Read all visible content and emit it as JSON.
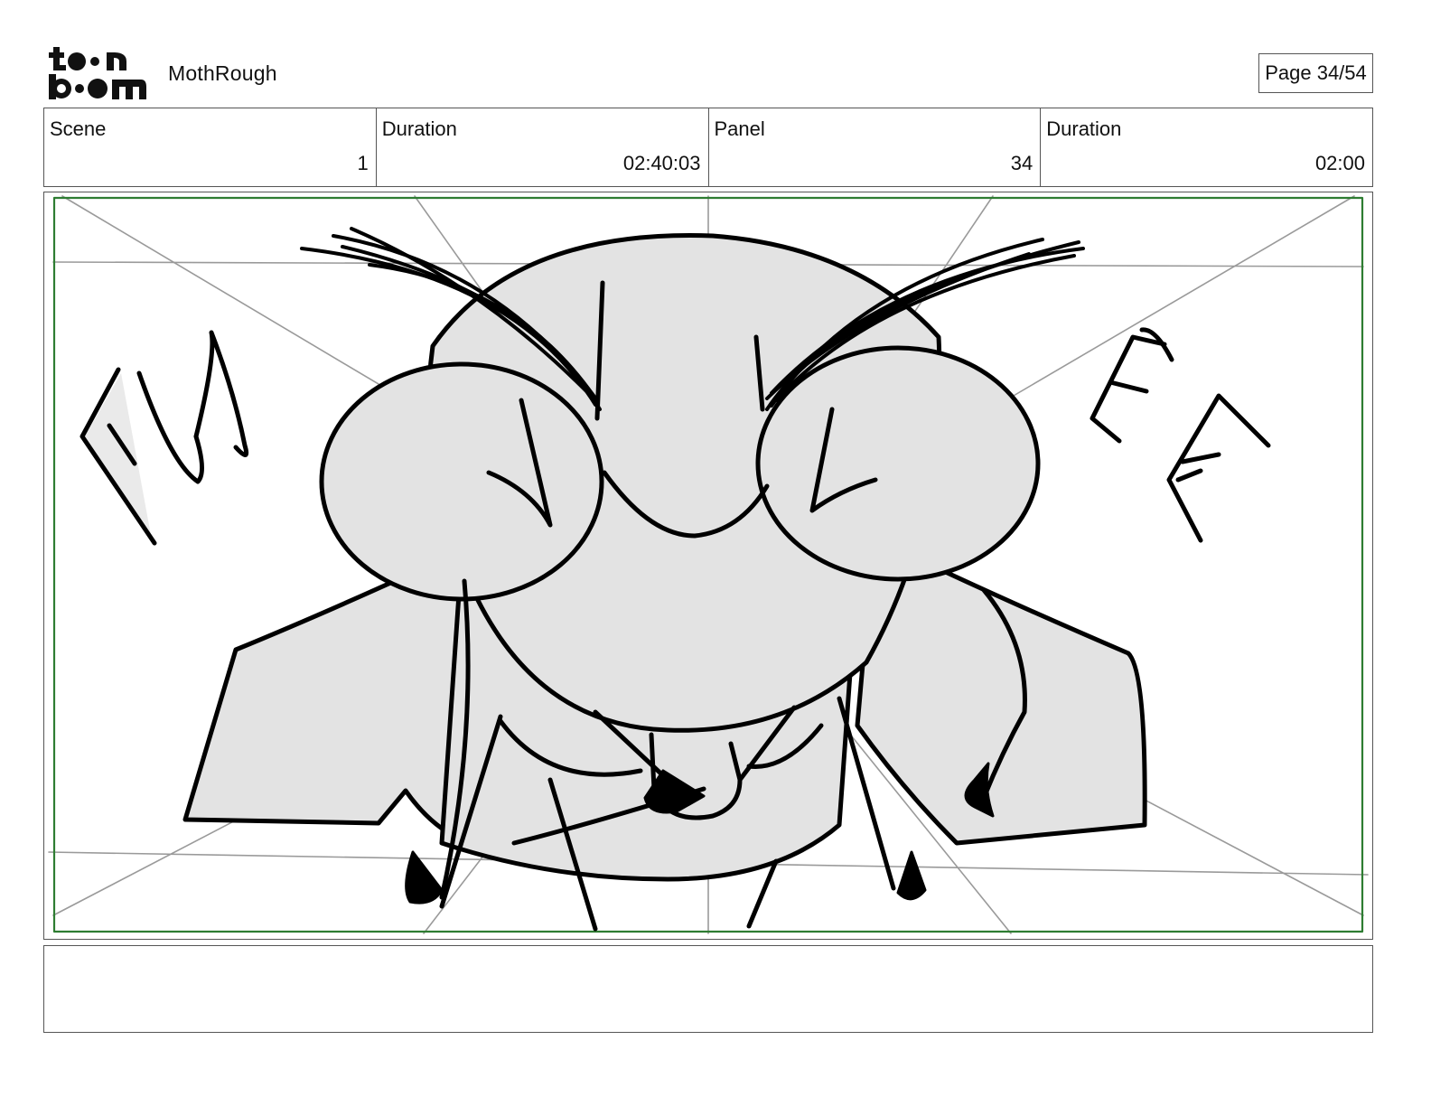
{
  "header": {
    "logo_text": "toon boom",
    "project_title": "MothRough",
    "page_label": "Page 34/54"
  },
  "info": {
    "scene_label": "Scene",
    "scene_value": "1",
    "scene_duration_label": "Duration",
    "scene_duration_value": "02:40:03",
    "panel_label": "Panel",
    "panel_value": "34",
    "panel_duration_label": "Duration",
    "panel_duration_value": "02:00"
  },
  "panel": {
    "sfx_left": "FW",
    "sfx_right": "EE",
    "colors": {
      "camera_frame": "#2e7d32",
      "fill": "#e3e3e3",
      "ink": "#000000",
      "guides": "#9a9a9a"
    }
  }
}
